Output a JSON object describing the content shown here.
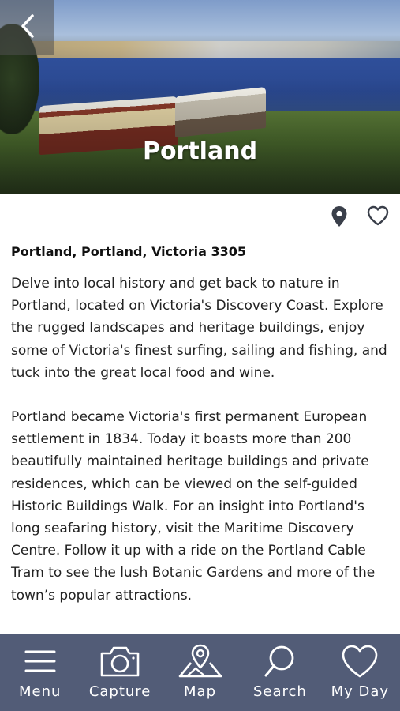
{
  "header": {
    "title": "Portland",
    "back_icon": "chevron-left-icon"
  },
  "actions": [
    {
      "icon": "map-pin-icon"
    },
    {
      "icon": "heart-icon"
    }
  ],
  "content": {
    "address": "Portland, Portland, Victoria 3305",
    "paragraphs": [
      "Delve into local history and get back to nature in Portland, located on Victoria's Discovery Coast. Explore the rugged landscapes and heritage buildings, enjoy some of Victoria's finest surfing, sailing and fishing, and tuck into the great local food and wine.",
      "Portland became Victoria's first permanent European settlement in 1834. Today it boasts more than 200 beautifully maintained heritage buildings and private residences, which can be viewed on the self-guided Historic Buildings Walk. For an insight into Portland's long seafaring history, visit the Maritime Discovery Centre. Follow it up with a ride on the Portland Cable Tram to see the lush Botanic Gardens and more of the town’s popular attractions."
    ]
  },
  "nav": {
    "items": [
      {
        "label": "Menu",
        "icon": "menu-icon"
      },
      {
        "label": "Capture",
        "icon": "camera-icon"
      },
      {
        "label": "Map",
        "icon": "map-icon"
      },
      {
        "label": "Search",
        "icon": "search-icon"
      },
      {
        "label": "My Day",
        "icon": "heart-icon"
      }
    ]
  },
  "colors": {
    "nav_background": "#525c77",
    "text": "#222222",
    "icon": "#3a3f4a"
  }
}
